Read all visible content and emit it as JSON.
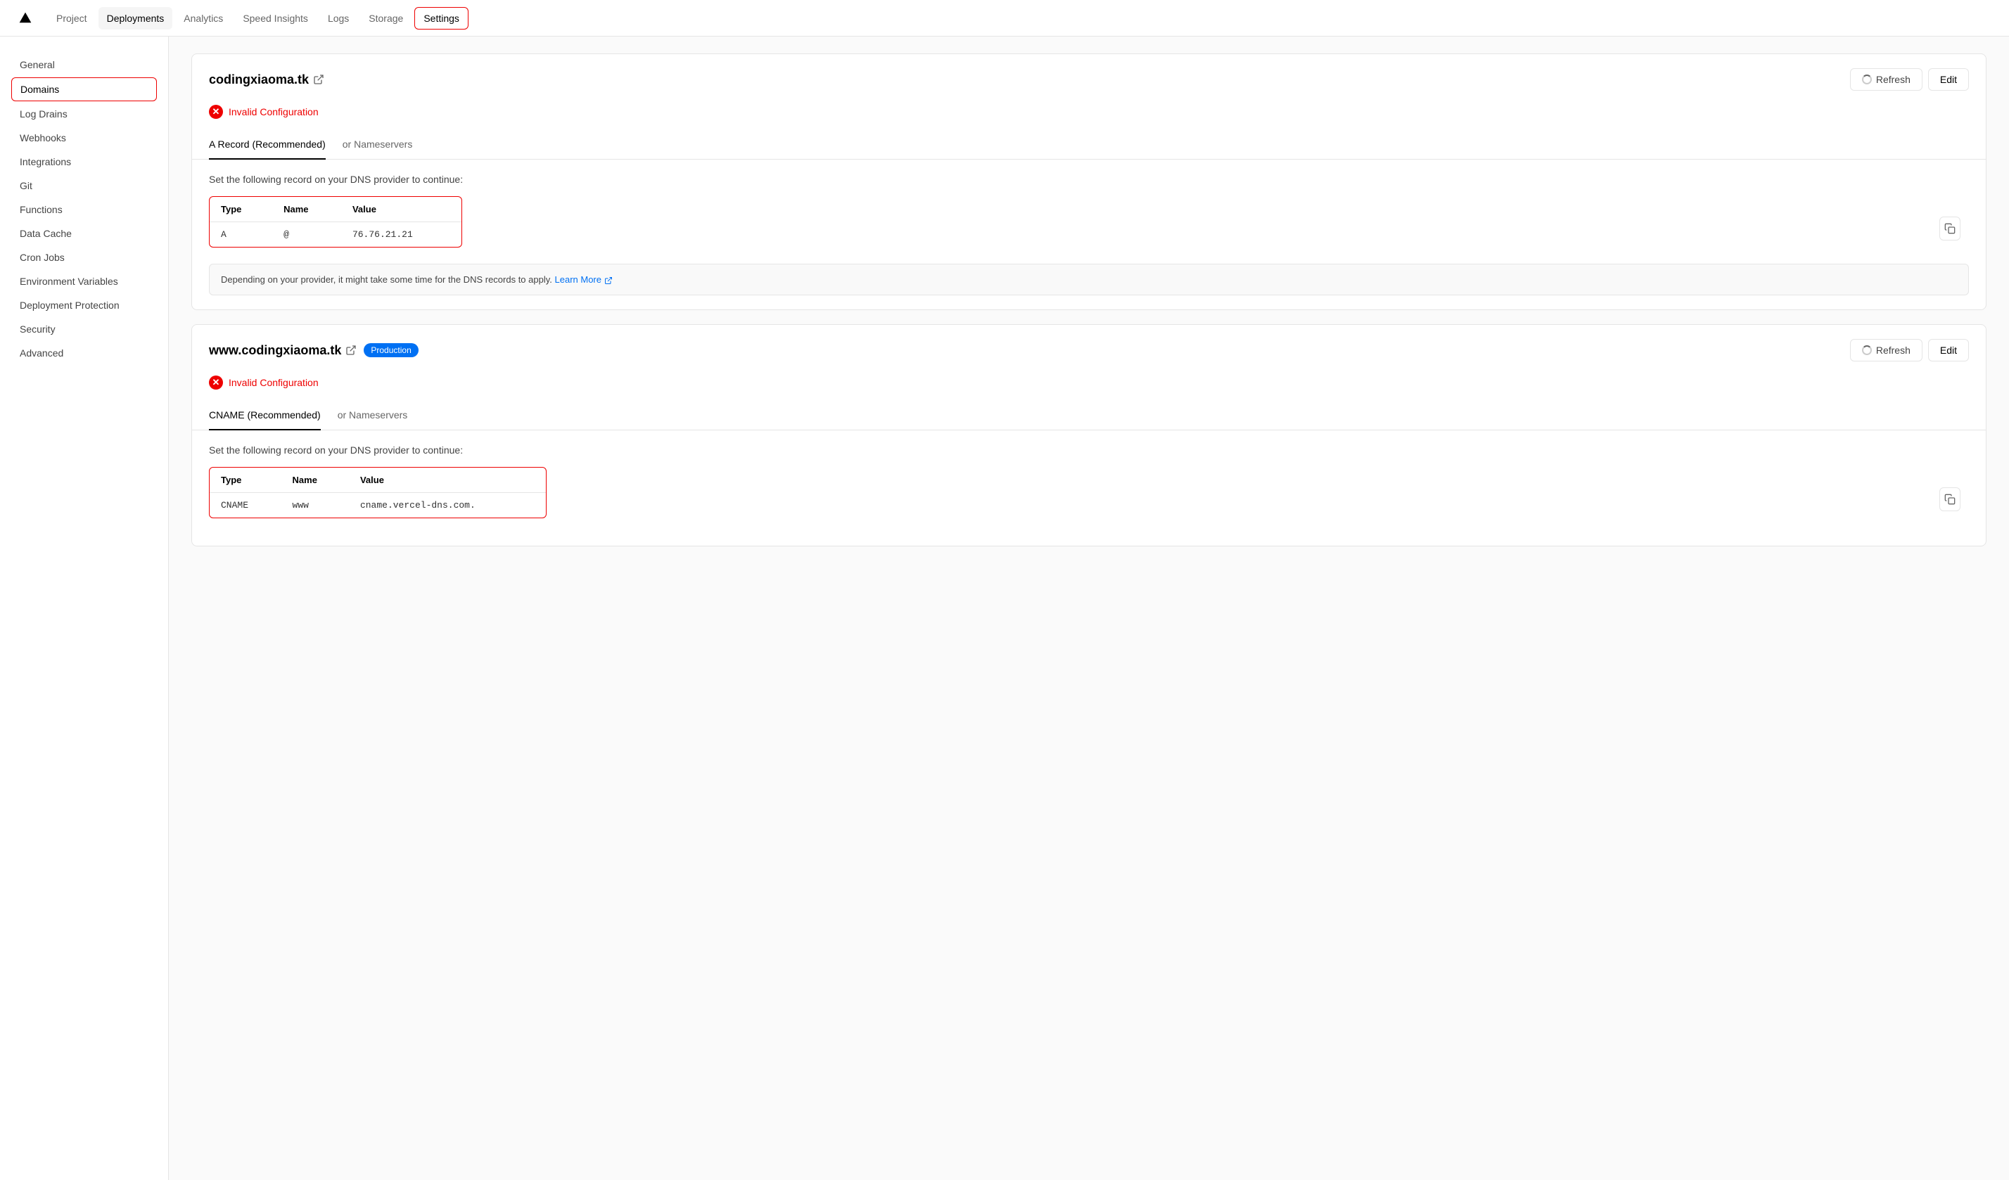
{
  "nav": {
    "logo_label": "▲",
    "items": [
      {
        "id": "project",
        "label": "Project",
        "active": false,
        "outlined": false
      },
      {
        "id": "deployments",
        "label": "Deployments",
        "active": true,
        "outlined": false
      },
      {
        "id": "analytics",
        "label": "Analytics",
        "active": false,
        "outlined": false
      },
      {
        "id": "speed-insights",
        "label": "Speed Insights",
        "active": false,
        "outlined": false
      },
      {
        "id": "logs",
        "label": "Logs",
        "active": false,
        "outlined": false
      },
      {
        "id": "storage",
        "label": "Storage",
        "active": false,
        "outlined": false
      },
      {
        "id": "settings",
        "label": "Settings",
        "active": false,
        "outlined": true
      }
    ]
  },
  "sidebar": {
    "items": [
      {
        "id": "general",
        "label": "General",
        "active": false
      },
      {
        "id": "domains",
        "label": "Domains",
        "active": true
      },
      {
        "id": "log-drains",
        "label": "Log Drains",
        "active": false
      },
      {
        "id": "webhooks",
        "label": "Webhooks",
        "active": false
      },
      {
        "id": "integrations",
        "label": "Integrations",
        "active": false
      },
      {
        "id": "git",
        "label": "Git",
        "active": false
      },
      {
        "id": "functions",
        "label": "Functions",
        "active": false
      },
      {
        "id": "data-cache",
        "label": "Data Cache",
        "active": false
      },
      {
        "id": "cron-jobs",
        "label": "Cron Jobs",
        "active": false
      },
      {
        "id": "environment-variables",
        "label": "Environment Variables",
        "active": false
      },
      {
        "id": "deployment-protection",
        "label": "Deployment Protection",
        "active": false
      },
      {
        "id": "security",
        "label": "Security",
        "active": false
      },
      {
        "id": "advanced",
        "label": "Advanced",
        "active": false
      }
    ]
  },
  "domain1": {
    "name": "codingxiaoma.tk",
    "external_link": "↗",
    "error_text": "Invalid Configuration",
    "refresh_label": "Refresh",
    "edit_label": "Edit",
    "tab_active": "A Record (Recommended)",
    "tab_inactive": "or Nameservers",
    "instruction": "Set the following record on your DNS provider to continue:",
    "table": {
      "headers": [
        "Type",
        "Name",
        "Value"
      ],
      "rows": [
        [
          "A",
          "@",
          "76.76.21.21"
        ]
      ]
    },
    "info_text": "Depending on your provider, it might take some time for the DNS records to apply.",
    "learn_more_text": "Learn More",
    "learn_more_icon": "↗"
  },
  "domain2": {
    "name": "www.codingxiaoma.tk",
    "external_link": "↗",
    "badge": "Production",
    "error_text": "Invalid Configuration",
    "refresh_label": "Refresh",
    "edit_label": "Edit",
    "tab_active": "CNAME (Recommended)",
    "tab_inactive": "or Nameservers",
    "instruction": "Set the following record on your DNS provider to continue:",
    "table": {
      "headers": [
        "Type",
        "Name",
        "Value"
      ],
      "rows": [
        [
          "CNAME",
          "www",
          "cname.vercel-dns.com."
        ]
      ]
    }
  }
}
